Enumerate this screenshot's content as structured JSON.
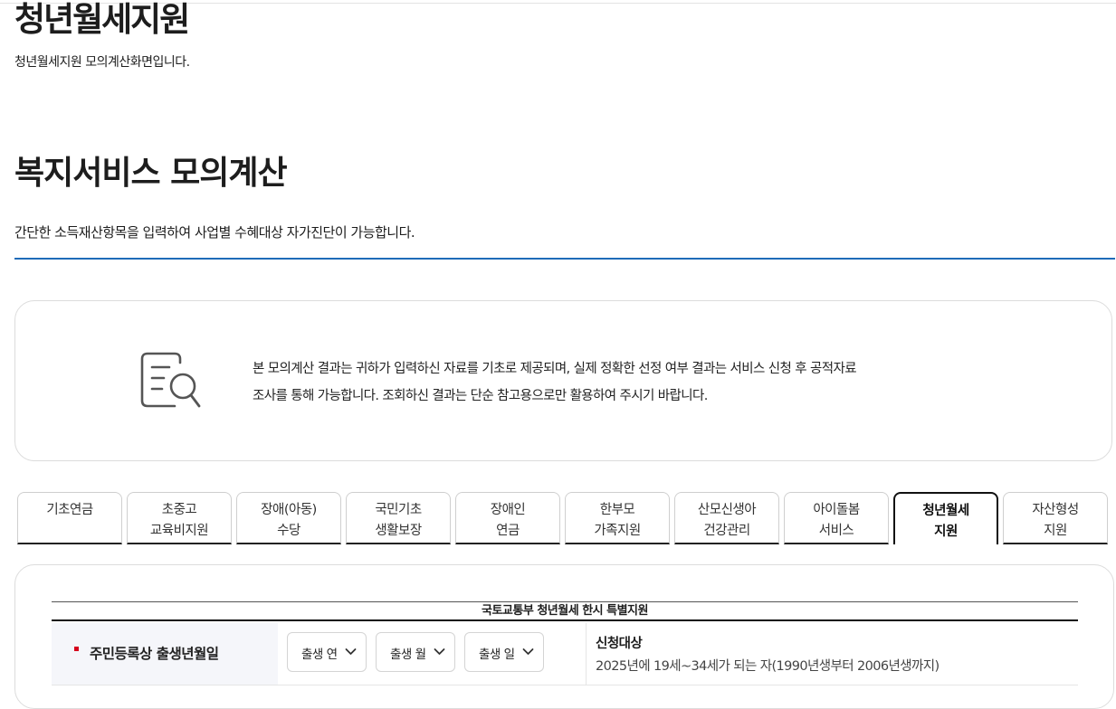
{
  "page": {
    "title": "청년월세지원",
    "subtitle": "청년월세지원 모의계산화면입니다."
  },
  "section": {
    "title": "복지서비스 모의계산",
    "description": "간단한 소득재산항목을 입력하여 사업별 수혜대상 자가진단이 가능합니다."
  },
  "notice": {
    "icon": "document-search-icon",
    "line1": "본 모의계산 결과는 귀하가 입력하신 자료를 기초로 제공되며, 실제 정확한 선정 여부 결과는 서비스 신청 후 공적자료",
    "line2": "조사를 통해 가능합니다. 조회하신 결과는 단순 참고용으로만 활용하여 주시기 바랍니다."
  },
  "tabs": [
    {
      "line1": "기초연금",
      "line2": ""
    },
    {
      "line1": "초중고",
      "line2": "교육비지원"
    },
    {
      "line1": "장애(아동)",
      "line2": "수당"
    },
    {
      "line1": "국민기초",
      "line2": "생활보장"
    },
    {
      "line1": "장애인",
      "line2": "연금"
    },
    {
      "line1": "한부모",
      "line2": "가족지원"
    },
    {
      "line1": "산모신생아",
      "line2": "건강관리"
    },
    {
      "line1": "아이돌봄",
      "line2": "서비스"
    },
    {
      "line1": "청년월세",
      "line2": "지원"
    },
    {
      "line1": "자산형성",
      "line2": "지원"
    }
  ],
  "active_tab": "청년월세 지원",
  "form": {
    "caption": "국토교통부 청년월세 한시 특별지원",
    "row_label": "주민등록상 출생년월일",
    "selects": {
      "year": "출생 연",
      "month": "출생 월",
      "day": "출생 일"
    },
    "info_title": "신청대상",
    "info_body": "2025년에 19세~34세가 되는 자(1990년생부터 2006년생까지)"
  },
  "colors": {
    "accent_rule": "#1e6bb8",
    "required_mark": "#d6001c",
    "label_bg": "#f5f6fa"
  }
}
